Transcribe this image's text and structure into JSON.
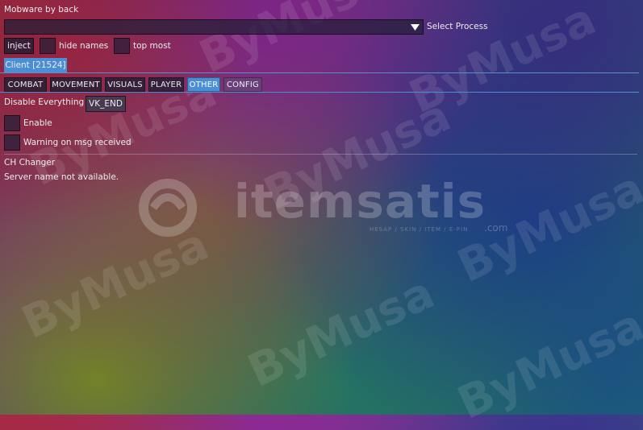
{
  "window": {
    "title": "Mobware by back"
  },
  "process": {
    "selected_value": "",
    "label": "Select Process"
  },
  "toolbar": {
    "inject_label": "inject",
    "hide_names_label": "hide names",
    "top_most_label": "top most"
  },
  "client_tab": {
    "label": "Client [21524]"
  },
  "tabs": [
    {
      "label": "COMBAT"
    },
    {
      "label": "MOVEMENT"
    },
    {
      "label": "VISUALS"
    },
    {
      "label": "PLAYER"
    },
    {
      "label": "OTHER",
      "active": true
    },
    {
      "label": "CONFIG"
    }
  ],
  "other": {
    "disable_everything_label": "Disable Everything",
    "hotkey_value": "VK_END",
    "enable_label": "Enable",
    "warning_label": "Warning on msg received",
    "ch_changer_label": "CH Changer",
    "server_status": "Server name not available."
  },
  "watermark": {
    "brand": "itemsatis",
    "tagline": "HESAP / SKIN / ITEM / E-PIN",
    "dotcom": ".com",
    "overlay_text": "ByMusa"
  },
  "colors": {
    "accent": "#4a8fd6",
    "separator": "#5a8ed0"
  }
}
